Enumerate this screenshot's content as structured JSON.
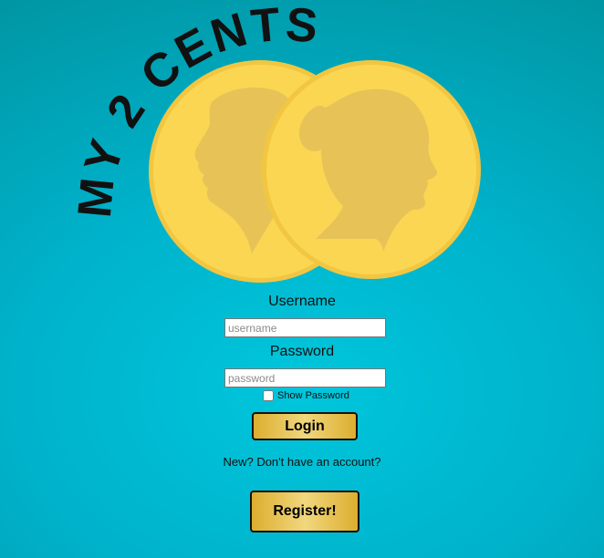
{
  "app": {
    "brand_text": "MY 2 CENTS"
  },
  "login_form": {
    "username_label": "Username",
    "username_placeholder": "username",
    "password_label": "Password",
    "password_placeholder": "password",
    "show_password_label": "Show Password",
    "show_password_checked": false,
    "login_button": "Login"
  },
  "signup": {
    "prompt": "New? Don't have an account?",
    "register_button": "Register!"
  },
  "colors": {
    "background": "#00b8d0",
    "coin_gold": "#fbd653",
    "coin_rim": "#f2c641",
    "silhouette": "#e7c357",
    "button_gold": "#e6c04f"
  }
}
